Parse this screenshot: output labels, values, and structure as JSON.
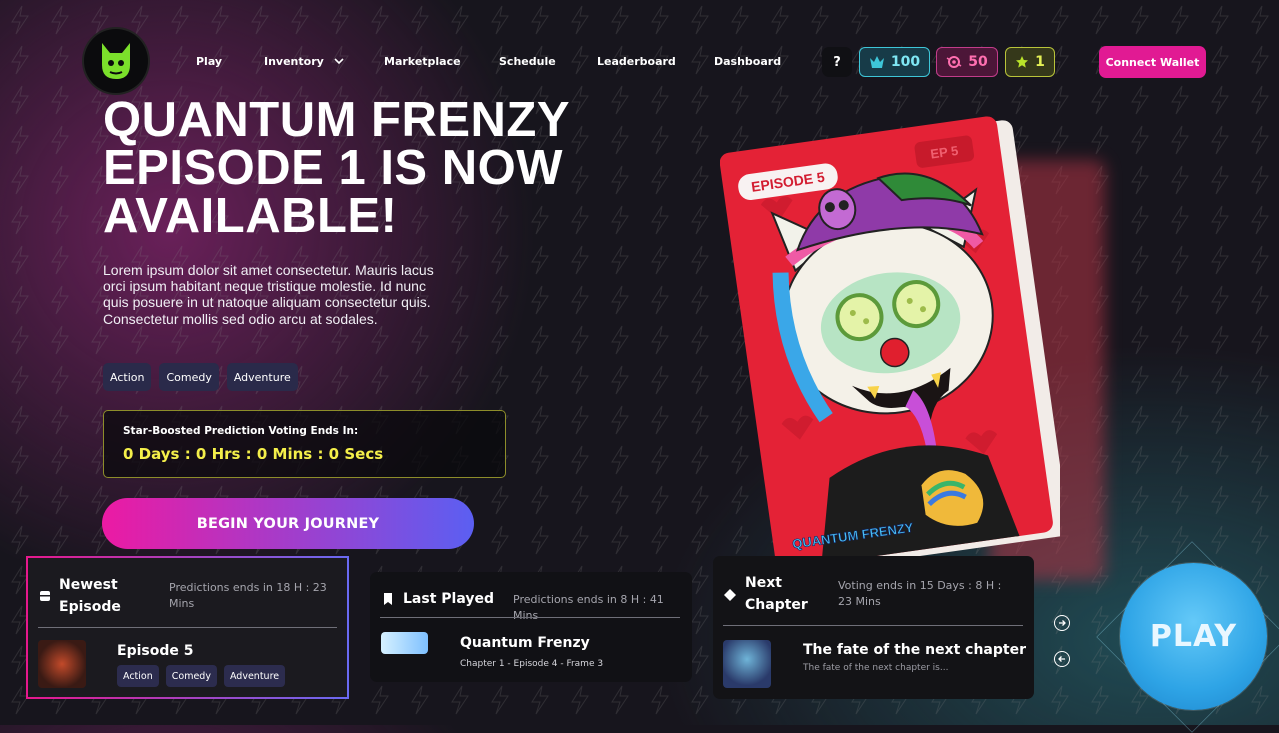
{
  "nav": {
    "items": [
      "Play",
      "Inventory",
      "Marketplace",
      "Schedule",
      "Leaderboard",
      "Dashboard"
    ],
    "help_label": "?",
    "gems": "100",
    "orbs": "50",
    "stars": "1",
    "connect_wallet": "Connect Wallet"
  },
  "hero": {
    "title": "QUANTUM FRENZY EPISODE 1 IS NOW AVAILABLE!",
    "description": "Lorem ipsum dolor sit amet consectetur. Mauris lacus orci ipsum habitant neque tristique molestie. Id nunc quis posuere in ut natoque aliquam consectetur quis. Consectetur mollis sed odio arcu at sodales.",
    "tags": [
      "Action",
      "Comedy",
      "Adventure"
    ],
    "countdown_label": "Star-Boosted Prediction Voting Ends In:",
    "countdown_value": "0 Days : 0 Hrs : 0 Mins : 0 Secs",
    "cta": "BEGIN YOUR JOURNEY"
  },
  "book": {
    "badge_episode": "EPISODE 5",
    "badge_ep": "EP 5",
    "brand": "QUANTUM FRENZY"
  },
  "cards": {
    "newest": {
      "title": "Newest Episode",
      "meta": "Predictions ends in 18 H : 23 Mins",
      "episode": "Episode 5",
      "tags": [
        "Action",
        "Comedy",
        "Adventure"
      ]
    },
    "last": {
      "title": "Last Played",
      "meta": "Predictions ends in 8 H : 41 Mins",
      "name": "Quantum Frenzy",
      "sub": "Chapter 1 - Episode 4 - Frame 3"
    },
    "next": {
      "title": "Next Chapter",
      "meta": "Voting ends in 15 Days : 8 H : 23 Mins",
      "name": "The fate of the next chapter",
      "sub": "The fate of the next chapter is..."
    }
  },
  "play_label": "PLAY",
  "colors": {
    "accent_pink": "#e11a93",
    "countdown_yellow": "#f4ef4a",
    "play_blue": "#2ea4e6"
  }
}
